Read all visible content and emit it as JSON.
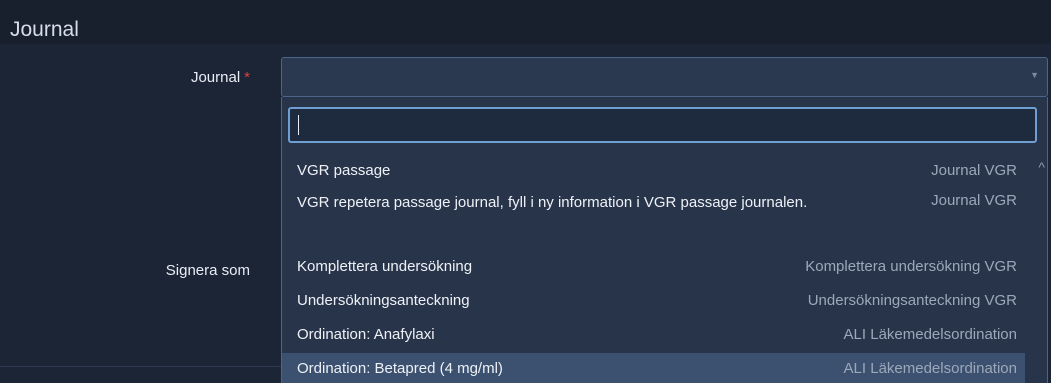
{
  "panel": {
    "title": "Journal"
  },
  "form": {
    "journal_label": "Journal",
    "required_mark": "*",
    "signera_label": "Signera som"
  },
  "dropdown": {
    "search_value": "",
    "options": [
      {
        "label": "VGR passage",
        "group": "Journal VGR"
      },
      {
        "label": "VGR repetera passage journal, fyll i ny information i VGR passage journalen.",
        "group": "Journal VGR"
      },
      {
        "label": "Komplettera undersökning",
        "group": "Komplettera undersökning VGR"
      },
      {
        "label": "Undersökningsanteckning",
        "group": "Undersökningsanteckning VGR"
      },
      {
        "label": "Ordination: Anafylaxi",
        "group": "ALI Läkemedelsordination"
      },
      {
        "label": "Ordination: Betapred (4 mg/ml)",
        "group": "ALI Läkemedelsordination"
      }
    ],
    "highlighted_index": 5
  },
  "icons": {
    "select_arrow": "chevron-down-icon",
    "scroll_up": "chevron-up-icon"
  }
}
